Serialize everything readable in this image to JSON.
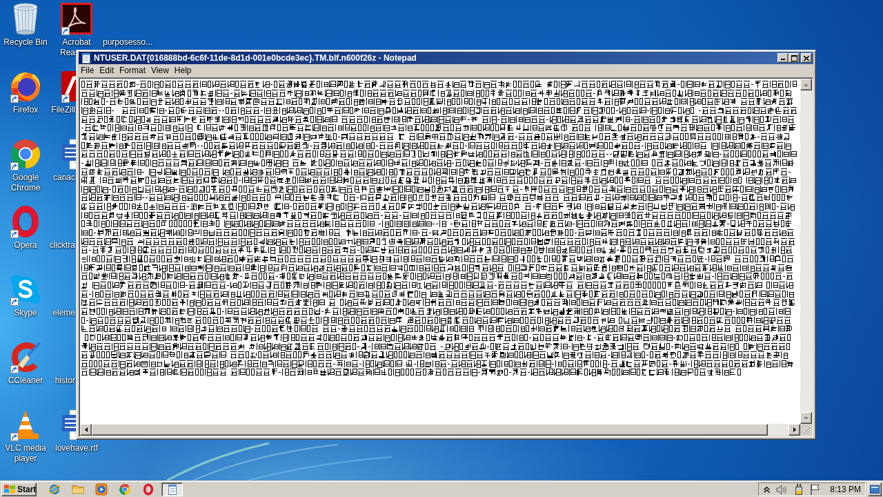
{
  "desktop": {
    "icon_columns": [
      {
        "icons": [
          {
            "kind": "recycle-bin",
            "label": "Recycle Bin"
          },
          {
            "kind": "firefox",
            "label": "Firefox",
            "shortcut": true
          },
          {
            "kind": "chrome",
            "label": "Google Chrome",
            "shortcut": true
          },
          {
            "kind": "opera",
            "label": "Opera",
            "shortcut": true
          },
          {
            "kind": "skype",
            "label": "Skype",
            "shortcut": true
          },
          {
            "kind": "ccleaner",
            "label": "CCleaner",
            "shortcut": true
          },
          {
            "kind": "vlc",
            "label": "VLC media player",
            "shortcut": true
          }
        ]
      },
      {
        "icons": [
          {
            "kind": "acrobat",
            "label": "Acrobat Rea",
            "shortcut": true
          },
          {
            "kind": "filezilla",
            "label": "FileZill",
            "shortcut": true
          },
          {
            "kind": "word",
            "label": "canac"
          },
          {
            "label": "clicktra"
          },
          {
            "label": "eleme"
          },
          {
            "label": "histor"
          },
          {
            "kind": "word",
            "label": "lovehave.rtf"
          }
        ]
      },
      {
        "icons": [
          {
            "label": "purposesso..."
          }
        ]
      }
    ]
  },
  "notepad": {
    "title": "NTUSER.DAT{016888bd-6c6f-11de-8d1d-001e0bcde3ec}.TM.blf.n600f26z - Notepad",
    "active": true,
    "menu": [
      {
        "label": "File"
      },
      {
        "label": "Edit"
      },
      {
        "label": "Format"
      },
      {
        "label": "View"
      },
      {
        "label": "Help"
      }
    ],
    "vertical_scrollbar": {
      "disabled": true
    },
    "horizontal_scrollbar": {
      "disabled": false
    }
  },
  "taskbar": {
    "start_button": {
      "label": "Start"
    },
    "quick_launch": [
      {
        "kind": "browser"
      },
      {
        "kind": "folder"
      },
      {
        "kind": "media-player"
      },
      {
        "kind": "chrome"
      },
      {
        "kind": "opera"
      }
    ],
    "tasks": [
      {
        "kind": "notepad",
        "selected": true
      }
    ],
    "tray": {
      "icons": [
        {
          "kind": "chevron"
        },
        {
          "kind": "speaker"
        },
        {
          "kind": "power"
        },
        {
          "kind": "flag"
        }
      ],
      "clock": "8:13 PM"
    }
  }
}
